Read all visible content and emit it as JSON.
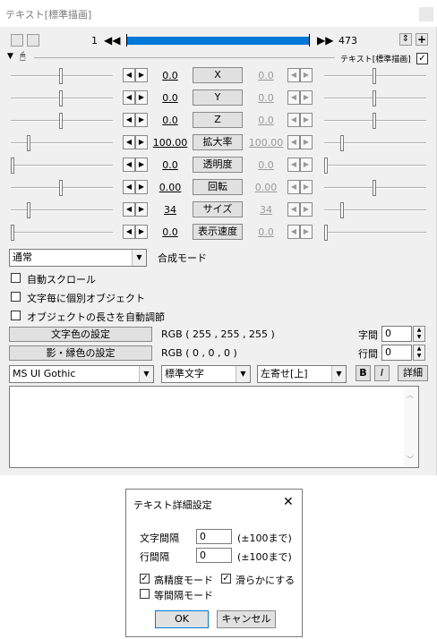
{
  "window": {
    "title": "テキスト[標準描画]"
  },
  "timeline": {
    "start_frame": "1",
    "end_frame": "473",
    "progress": 1.0
  },
  "object_label": "テキスト[標準描画]",
  "params": [
    {
      "name": "X",
      "left": "0.0",
      "right": "0.0",
      "left_pos": 0.5,
      "right_pos": 0.5
    },
    {
      "name": "Y",
      "left": "0.0",
      "right": "0.0",
      "left_pos": 0.5,
      "right_pos": 0.5
    },
    {
      "name": "Z",
      "left": "0.0",
      "right": "0.0",
      "left_pos": 0.5,
      "right_pos": 0.5
    },
    {
      "name": "拡大率",
      "left": "100.00",
      "right": "100.00",
      "left_pos": 0.17,
      "right_pos": 0.17
    },
    {
      "name": "透明度",
      "left": "0.0",
      "right": "0.0",
      "left_pos": 0.0,
      "right_pos": 0.0
    },
    {
      "name": "回転",
      "left": "0.00",
      "right": "0.00",
      "left_pos": 0.5,
      "right_pos": 0.5
    },
    {
      "name": "サイズ",
      "left": "34",
      "right": "34",
      "left_pos": 0.17,
      "right_pos": 0.17
    },
    {
      "name": "表示速度",
      "left": "0.0",
      "right": "0.0",
      "left_pos": 0.0,
      "right_pos": 0.0
    }
  ],
  "blend": {
    "value": "通常",
    "label": "合成モード"
  },
  "checks": {
    "auto_scroll": "自動スクロール",
    "per_char": "文字毎に個別オブジェクト",
    "auto_length": "オブジェクトの長さを自動調節"
  },
  "color": {
    "text_btn": "文字色の設定",
    "text_rgb": "RGB ( 255 , 255 , 255 )",
    "shadow_btn": "影・縁色の設定",
    "shadow_rgb": "RGB ( 0 , 0 , 0 )"
  },
  "spacing": {
    "char_label": "字間",
    "char_value": "0",
    "line_label": "行間",
    "line_value": "0"
  },
  "font": {
    "family": "MS UI Gothic",
    "style": "標準文字",
    "align": "左寄せ[上]",
    "bold": "B",
    "italic": "I",
    "detail": "詳細"
  },
  "dialog": {
    "title": "テキスト詳細設定",
    "char_spacing_label": "文字間隔",
    "char_spacing_value": "0",
    "char_spacing_range": "(±100まで)",
    "line_spacing_label": "行間隔",
    "line_spacing_value": "0",
    "line_spacing_range": "(±100まで)",
    "high_precision": "高精度モード",
    "smooth": "滑らかにする",
    "monospace": "等間隔モード",
    "ok": "OK",
    "cancel": "キャンセル"
  },
  "colors": {
    "accent": "#0078d7",
    "window_bg": "#f0f0f0"
  }
}
